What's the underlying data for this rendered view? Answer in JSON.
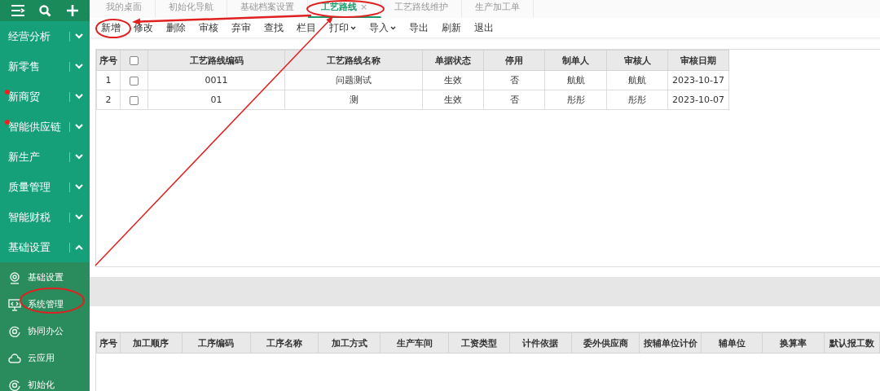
{
  "sidebar": {
    "items": [
      {
        "label": "经营分析",
        "expanded": false,
        "badge": false
      },
      {
        "label": "新零售",
        "expanded": false,
        "badge": false
      },
      {
        "label": "新商贸",
        "expanded": false,
        "badge": true
      },
      {
        "label": "智能供应链",
        "expanded": false,
        "badge": true
      },
      {
        "label": "新生产",
        "expanded": false,
        "badge": false
      },
      {
        "label": "质量管理",
        "expanded": false,
        "badge": false
      },
      {
        "label": "智能财税",
        "expanded": false,
        "badge": false
      },
      {
        "label": "基础设置",
        "expanded": true,
        "badge": false
      }
    ],
    "sub_items": [
      {
        "label": "基础设置",
        "kind": "camera"
      },
      {
        "label": "系统管理",
        "kind": "monitor"
      },
      {
        "label": "协同办公",
        "kind": "ring"
      },
      {
        "label": "云应用",
        "kind": "cloud"
      },
      {
        "label": "初始化",
        "kind": "ring"
      }
    ]
  },
  "tabs": [
    {
      "label": "我的桌面",
      "selected": false
    },
    {
      "label": "初始化导航",
      "selected": false
    },
    {
      "label": "基础档案设置",
      "selected": false
    },
    {
      "label": "工艺路线",
      "selected": true,
      "close": "×"
    },
    {
      "label": "工艺路线维护",
      "selected": false
    },
    {
      "label": "生产加工单",
      "selected": false
    }
  ],
  "toolbar": [
    {
      "label": "新增",
      "dropdown": false
    },
    {
      "label": "修改",
      "dropdown": false
    },
    {
      "label": "删除",
      "dropdown": false
    },
    {
      "label": "审核",
      "dropdown": false
    },
    {
      "label": "弃审",
      "dropdown": false
    },
    {
      "label": "查找",
      "dropdown": false
    },
    {
      "label": "栏目",
      "dropdown": false
    },
    {
      "label": "打印",
      "dropdown": true
    },
    {
      "label": "导入",
      "dropdown": true
    },
    {
      "label": "导出",
      "dropdown": false
    },
    {
      "label": "刷新",
      "dropdown": false
    },
    {
      "label": "退出",
      "dropdown": false
    }
  ],
  "routes_table": {
    "columns": [
      {
        "kind": "text",
        "label": "序号"
      },
      {
        "kind": "checkbox",
        "checked": false
      },
      {
        "kind": "text",
        "label": "工艺路线编码"
      },
      {
        "kind": "text",
        "label": "工艺路线名称"
      },
      {
        "kind": "text",
        "label": "单据状态"
      },
      {
        "kind": "text",
        "label": "停用"
      },
      {
        "kind": "text",
        "label": "制单人"
      },
      {
        "kind": "text",
        "label": "审核人"
      },
      {
        "kind": "text",
        "label": "审核日期"
      }
    ],
    "rows": [
      [
        {
          "kind": "text",
          "text": "1"
        },
        {
          "kind": "checkbox",
          "checked": false
        },
        {
          "kind": "text",
          "text": "0011"
        },
        {
          "kind": "text",
          "text": "问题测试"
        },
        {
          "kind": "text",
          "text": "生效"
        },
        {
          "kind": "text",
          "text": "否"
        },
        {
          "kind": "text",
          "text": "航航"
        },
        {
          "kind": "text",
          "text": "航航"
        },
        {
          "kind": "text",
          "text": "2023-10-17"
        }
      ],
      [
        {
          "kind": "text",
          "text": "2"
        },
        {
          "kind": "checkbox",
          "checked": false
        },
        {
          "kind": "text",
          "text": "01"
        },
        {
          "kind": "text",
          "text": "测"
        },
        {
          "kind": "text",
          "text": "生效"
        },
        {
          "kind": "text",
          "text": "否"
        },
        {
          "kind": "text",
          "text": "彤彤"
        },
        {
          "kind": "text",
          "text": "彤彤"
        },
        {
          "kind": "text",
          "text": "2023-10-07"
        }
      ]
    ]
  },
  "steps_table": {
    "columns": [
      "序号",
      "加工顺序",
      "工序编码",
      "工序名称",
      "加工方式",
      "生产车间",
      "工资类型",
      "计件依据",
      "委外供应商",
      "按辅单位计价",
      "辅单位",
      "换算率",
      "默认报工数"
    ]
  }
}
